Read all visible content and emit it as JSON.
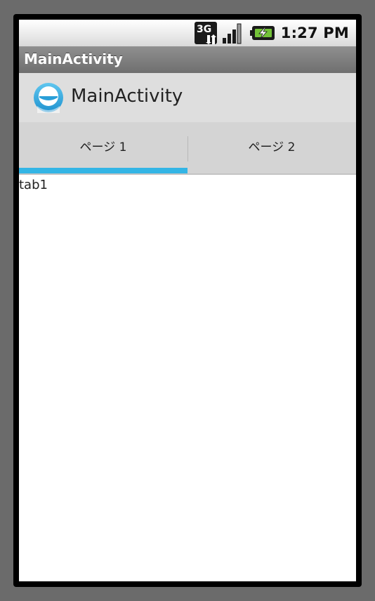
{
  "status_bar": {
    "network_label": "3G",
    "time": "1:27 PM",
    "icons": [
      "network-3g-icon",
      "signal-strength-icon",
      "battery-charging-icon"
    ]
  },
  "title_bar": {
    "title": "MainActivity"
  },
  "action_bar": {
    "app_icon": "app-launcher-icon",
    "title": "MainActivity"
  },
  "tabs": [
    {
      "label": "ページ 1",
      "selected": true
    },
    {
      "label": "ページ 2",
      "selected": false
    }
  ],
  "content": {
    "text": "tab1"
  },
  "colors": {
    "tab_indicator": "#33b5e5",
    "tab_strip": "#d4d4d4",
    "action_bar": "#dedede",
    "title_bar": "#7f7f7f"
  }
}
